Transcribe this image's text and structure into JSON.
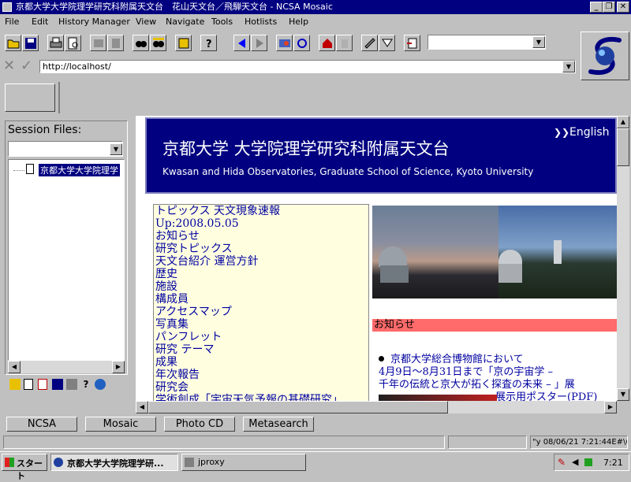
{
  "window": {
    "title": "京都大学大学院理学研究科附属天文台　花山天文台／飛騨天文台 - NCSA Mosaic"
  },
  "menu": [
    "File",
    "Edit",
    "History Manager",
    "View",
    "Navigate",
    "Tools",
    "Hotlists",
    "Help"
  ],
  "address": {
    "url": "http://localhost/"
  },
  "session": {
    "label": "Session Files:",
    "tree_item": "京都大学大学院理学"
  },
  "banner": {
    "title": "京都大学 大学院理学研究科附属天文台",
    "subtitle": "Kwasan and Hida Observatories, Graduate School of Science, Kyoto University",
    "english_link": "English"
  },
  "nav_links": [
    "トピックス 天文現象速報",
    "Up:2008.05.05",
    "お知らせ",
    "研究トピックス",
    "天文台紹介 運営方針",
    "歴史",
    "施設",
    "構成員",
    "アクセスマップ",
    "写真集",
    "パンフレット",
    "研究 テーマ",
    "成果",
    "年次報告",
    "研究会",
    "学術創成「宇宙天気予報の基礎研究」"
  ],
  "section": {
    "heading": "お知らせ"
  },
  "news": {
    "line1": "京都大学総合博物館において",
    "line2": "4月9日～8月31日まで「京の宇宙学 –",
    "line3": "千年の伝統と京大が拓く探査の未来 – 」展",
    "line4": "展示用ポスター(PDF)"
  },
  "bottom_buttons": [
    "NCSA",
    "Mosaic",
    "Photo CD",
    "Metasearch"
  ],
  "status": {
    "text": "\"y 08/06/21 7:21:44E#\\u00e3o"
  },
  "taskbar": {
    "start": "スタート",
    "task1": "京都大学大学院理学研...",
    "task2": "jproxy",
    "clock": "7:21"
  },
  "colors": {
    "titlebar": "#000080",
    "banner": "#000080",
    "link": "#0000a0",
    "nav_bg": "#ffffe0",
    "section_bar": "#ff6a6a"
  }
}
